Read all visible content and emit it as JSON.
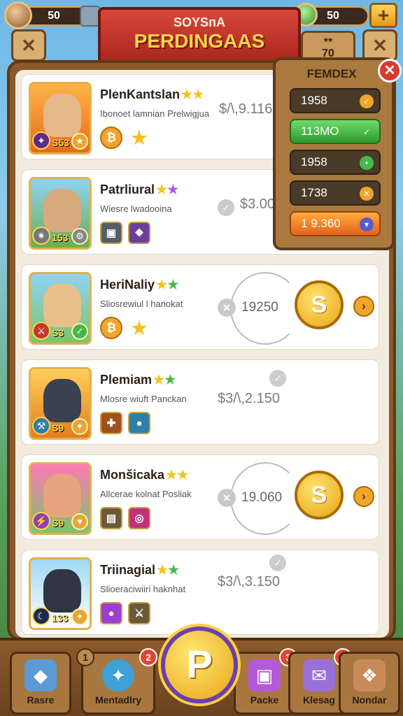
{
  "top": {
    "coins": "50",
    "gems": "50",
    "banner_sub": "SOYSпA",
    "banner_title": "PERDINGAAS",
    "level_label": "**",
    "level_value": "70",
    "plus_label": "+"
  },
  "cards": [
    {
      "name": "PlenKantslan",
      "desc": "Ibonoet lamnian Prelwigjua",
      "level": "S53",
      "price": "$/\\,9.116"
    },
    {
      "name": "Patrliural",
      "desc": "Wiesre lwadooina",
      "level": "153",
      "price": "$3.00"
    },
    {
      "name": "HeriNaliy",
      "desc": "Sliosrewiul l hanokat",
      "level": "S3",
      "ring_value": "19250"
    },
    {
      "name": "Plemiam",
      "desc": "Mlosre wiuft Panckan",
      "level": "S9",
      "price": "$3/\\,2.150"
    },
    {
      "name": "Monšicaka",
      "desc": "Allcerae kolnat Posliak",
      "level": "S9",
      "ring_value": "19.060"
    },
    {
      "name": "Triinagial",
      "desc": "Slioeraciwiiri haknhat",
      "level": "133",
      "price": "$3/\\,3.150"
    }
  ],
  "panel": {
    "title": "FEMDEX",
    "items": [
      "1958",
      "113MO",
      "1958",
      "1738",
      "1 9.360"
    ]
  },
  "nav": [
    {
      "label": "Rasre",
      "badge": ""
    },
    {
      "label": "Mentadlry",
      "badge": "2",
      "badge2": "1"
    },
    {
      "label": "Packe",
      "badge": "3"
    },
    {
      "label": "Klesag",
      "badge": "1"
    },
    {
      "label": "Nondar",
      "badge": ""
    }
  ],
  "colors": {
    "frame": "#8b5a2b",
    "banner": "#d9473a",
    "accent_gold": "#f4c21f",
    "panel_green": "#2f9a2f",
    "panel_orange": "#e2621c"
  }
}
